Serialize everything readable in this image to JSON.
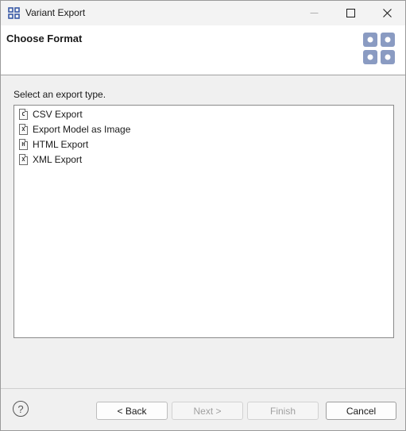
{
  "window": {
    "title": "Variant Export",
    "controls": {
      "minimize": "–",
      "maximize": "□",
      "close": "✕"
    }
  },
  "banner": {
    "title": "Choose Format",
    "icon": "wizard-banner-grid-icon",
    "icon_color": "#8a9bc2"
  },
  "content": {
    "prompt": "Select an export type.",
    "export_types": [
      {
        "label": "CSV Export",
        "icon_letter": "C"
      },
      {
        "label": "Export Model as Image",
        "icon_letter": "X"
      },
      {
        "label": "HTML Export",
        "icon_letter": "H"
      },
      {
        "label": "XML Export",
        "icon_letter": "X"
      }
    ]
  },
  "footer": {
    "help_label": "?",
    "back_label": "< Back",
    "next_label": "Next >",
    "finish_label": "Finish",
    "cancel_label": "Cancel"
  }
}
